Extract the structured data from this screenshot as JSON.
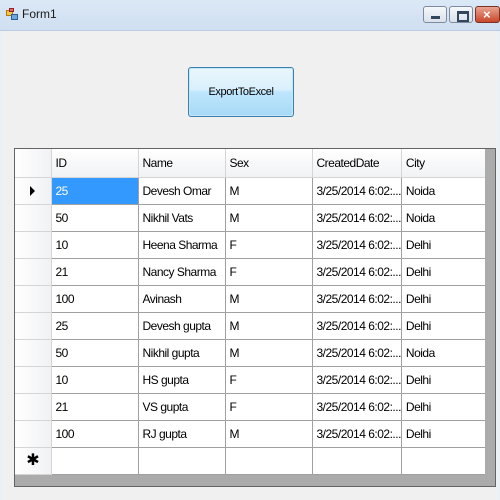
{
  "window": {
    "title": "Form1"
  },
  "toolbar": {
    "export_label": "ExportToExcel"
  },
  "grid": {
    "columns": [
      "ID",
      "Name",
      "Sex",
      "CreatedDate",
      "City"
    ],
    "rows": [
      [
        "25",
        "Devesh Omar",
        "M",
        "3/25/2014 6:02:...",
        "Noida"
      ],
      [
        "50",
        "Nikhil Vats",
        "M",
        "3/25/2014 6:02:...",
        "Noida"
      ],
      [
        "10",
        "Heena Sharma",
        "F",
        "3/25/2014 6:02:...",
        "Delhi"
      ],
      [
        "21",
        "Nancy Sharma",
        "F",
        "3/25/2014 6:02:...",
        "Delhi"
      ],
      [
        "100",
        "Avinash",
        "M",
        "3/25/2014 6:02:...",
        "Delhi"
      ],
      [
        "25",
        "Devesh gupta",
        "M",
        "3/25/2014 6:02:...",
        "Delhi"
      ],
      [
        "50",
        "Nikhil gupta",
        "M",
        "3/25/2014 6:02:...",
        "Noida"
      ],
      [
        "10",
        "HS gupta",
        "F",
        "3/25/2014 6:02:...",
        "Delhi"
      ],
      [
        "21",
        "VS gupta",
        "F",
        "3/25/2014 6:02:...",
        "Delhi"
      ],
      [
        "100",
        "RJ gupta",
        "M",
        "3/25/2014 6:02:...",
        "Delhi"
      ]
    ],
    "new_row_marker": "✱",
    "current_row_indicator": "arrow-right-icon",
    "selection_color": "#3399ff"
  }
}
